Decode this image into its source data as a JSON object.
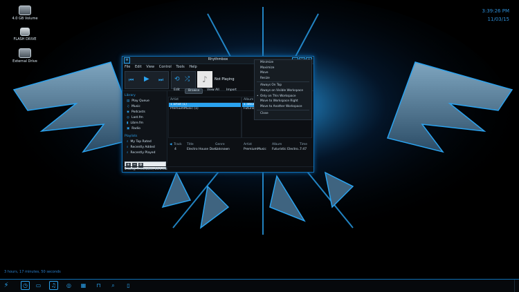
{
  "desktop": {
    "icons": [
      {
        "label": "4.0 GB Volume",
        "icon": "drive-icon"
      },
      {
        "label": "FLASH DRIVE",
        "icon": "flash-drive-icon"
      },
      {
        "label": "External Drive",
        "icon": "drive-icon"
      }
    ],
    "clock": {
      "time": "3:39:26 PM",
      "date": "11/03/15"
    },
    "uptime": "3 hours, 17 minutes, 50 seconds"
  },
  "window": {
    "title": "Rhythmbox",
    "menu": [
      "File",
      "Edit",
      "View",
      "Control",
      "Tools",
      "Help"
    ],
    "now_playing": "Not Playing",
    "sidebar": {
      "library_heading": "Library",
      "library_items": [
        "Play Queue",
        "Music",
        "Podcasts",
        "Last.fm",
        "Libre.fm",
        "Radio"
      ],
      "playlists_heading": "Playlists",
      "playlist_items": [
        "My Top Rated",
        "Recently Added",
        "Recently Played"
      ]
    },
    "browser_tabs": [
      "Edit",
      "Browse",
      "View All",
      "Import"
    ],
    "active_tab": "Browse",
    "artist_pane": {
      "header": "Artist",
      "rows": [
        "1 artist (1)",
        "PremiumMusic (1)"
      ]
    },
    "album_pane": {
      "header": "Album",
      "rows": [
        "1 album",
        "Futuristic"
      ]
    },
    "tracks": {
      "columns": [
        "Track",
        "Title",
        "Genre",
        "Artist",
        "Album",
        "Time"
      ],
      "rows": [
        {
          "track": "4",
          "title": "Electro House Dan...",
          "genre": "Unknown",
          "artist": "PremiumMusic",
          "album": "Futuristic Electro...",
          "time": "7:47"
        }
      ]
    },
    "status": "1 song, 7 minutes, 13.1 MB"
  },
  "context_menu": {
    "items": [
      "Minimize",
      "Maximize",
      "Move",
      "Resize",
      "Always On Top",
      "Always on Visible Workspace",
      "Only on This Workspace",
      "Move to Workspace Right",
      "Move to Another Workspace",
      "Close"
    ],
    "checked": "Only on This Workspace"
  },
  "colors": {
    "accent": "#2aa3f0",
    "background": "#000000"
  }
}
